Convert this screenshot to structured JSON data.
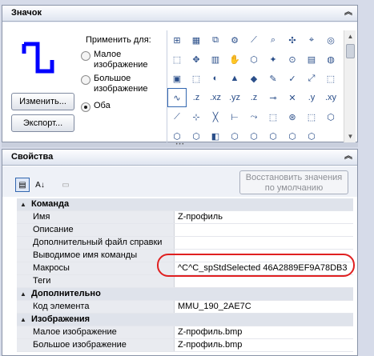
{
  "icon_panel": {
    "title": "Значок",
    "apply_for_label": "Применить для:",
    "radio_options": [
      {
        "label": "Малое\nизображение",
        "selected": false
      },
      {
        "label": "Большое\nизображение",
        "selected": false
      },
      {
        "label": "Оба",
        "selected": true
      }
    ],
    "edit_button": "Изменить...",
    "export_button": "Экспорт...",
    "cut_label": "Изображение"
  },
  "icon_grid": [
    "⊞",
    "▦",
    "⧉",
    "⚙",
    "⟋",
    "⌕",
    "✣",
    "⌖",
    "◎",
    "⬚",
    "✥",
    "▥",
    "✋",
    "⬡",
    "✦",
    "⊙",
    "▤",
    "◍",
    "▣",
    "⬚",
    "◐",
    "▲",
    "◆",
    "✎",
    "✓",
    "⤢",
    "⬚",
    "∿",
    ".z",
    ".xz",
    ".yz",
    ".z",
    "⊸",
    "✕",
    ".y",
    ".xy",
    "⟋",
    "⊹",
    "╳",
    "⊢",
    "⤳",
    "⬚",
    "⊛",
    "⬚",
    "⬡",
    "⬡",
    "⬡",
    "◧",
    "⬡",
    "⬡",
    "⬡",
    "⬡",
    "⬡"
  ],
  "props_panel": {
    "title": "Свойства",
    "restore_button": "Восстановить значения\nпо умолчанию",
    "categories": [
      {
        "name": "Команда",
        "props": [
          {
            "name": "Имя",
            "value": "Z-профиль"
          },
          {
            "name": "Описание",
            "value": ""
          },
          {
            "name": "Дополнительный файл справки",
            "value": ""
          },
          {
            "name": "Выводимое имя команды",
            "value": ""
          },
          {
            "name": "Макросы",
            "value": "^C^C_spStdSelected 46A2889EF9A78DB3"
          },
          {
            "name": "Теги",
            "value": ""
          }
        ]
      },
      {
        "name": "Дополнительно",
        "props": [
          {
            "name": "Код элемента",
            "value": "MMU_190_2AE7C"
          }
        ]
      },
      {
        "name": "Изображения",
        "props": [
          {
            "name": "Малое изображение",
            "value": "Z-профиль.bmp"
          },
          {
            "name": "Большое изображение",
            "value": "Z-профиль.bmp"
          }
        ]
      }
    ]
  },
  "colors": {
    "accent_blue": "#0000ff",
    "highlight_red": "#e02020"
  }
}
